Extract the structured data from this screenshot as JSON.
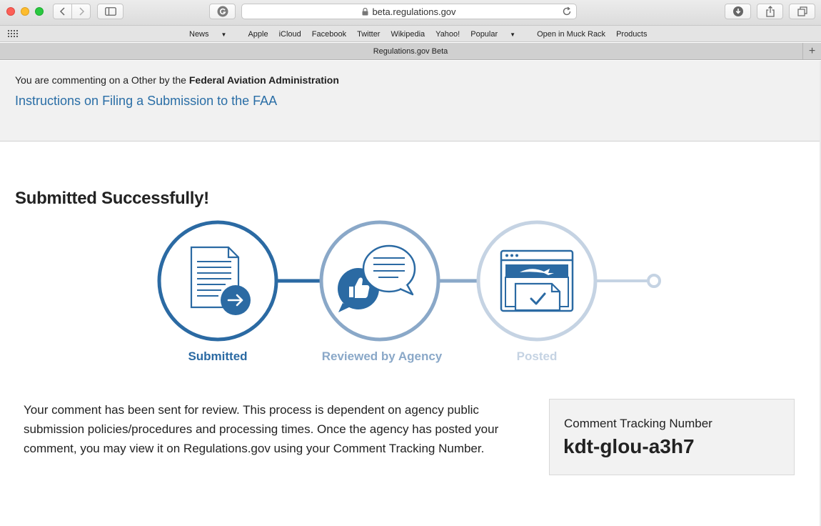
{
  "browser": {
    "url": "beta.regulations.gov",
    "favorites": [
      {
        "label": "News",
        "has_menu": true
      },
      {
        "label": "Apple"
      },
      {
        "label": "iCloud"
      },
      {
        "label": "Facebook"
      },
      {
        "label": "Twitter"
      },
      {
        "label": "Wikipedia"
      },
      {
        "label": "Yahoo!"
      },
      {
        "label": "Popular",
        "has_menu": true
      },
      {
        "label": "Open in Muck Rack"
      },
      {
        "label": "Products"
      }
    ],
    "tab_title": "Regulations.gov Beta",
    "new_tab": "+"
  },
  "context": {
    "prefix": "You are commenting on a Other by the ",
    "agency": "Federal Aviation Administration",
    "instructions_link": "Instructions on Filing a Submission to the FAA"
  },
  "main": {
    "heading": "Submitted Successfully!",
    "steps": [
      {
        "label": "Submitted",
        "status": "complete",
        "icon": "document-send-icon"
      },
      {
        "label": "Reviewed by Agency",
        "status": "upcoming",
        "icon": "chat-thumbs-up-icon"
      },
      {
        "label": "Posted",
        "status": "upcoming",
        "icon": "web-posted-icon"
      }
    ],
    "message": "Your comment has been sent for review. This process is dependent on agency public submission policies/procedures and processing times. Once the agency has posted your comment, you may view it on Regulations.gov using your Comment Tracking Number.",
    "tracking_label": "Comment Tracking Number",
    "tracking_number": "kdt-glou-a3h7"
  },
  "colors": {
    "step1": "#2b6aa3",
    "step2": "#8aa8c8",
    "step3": "#c5d3e3",
    "link": "#2a6ea6"
  }
}
